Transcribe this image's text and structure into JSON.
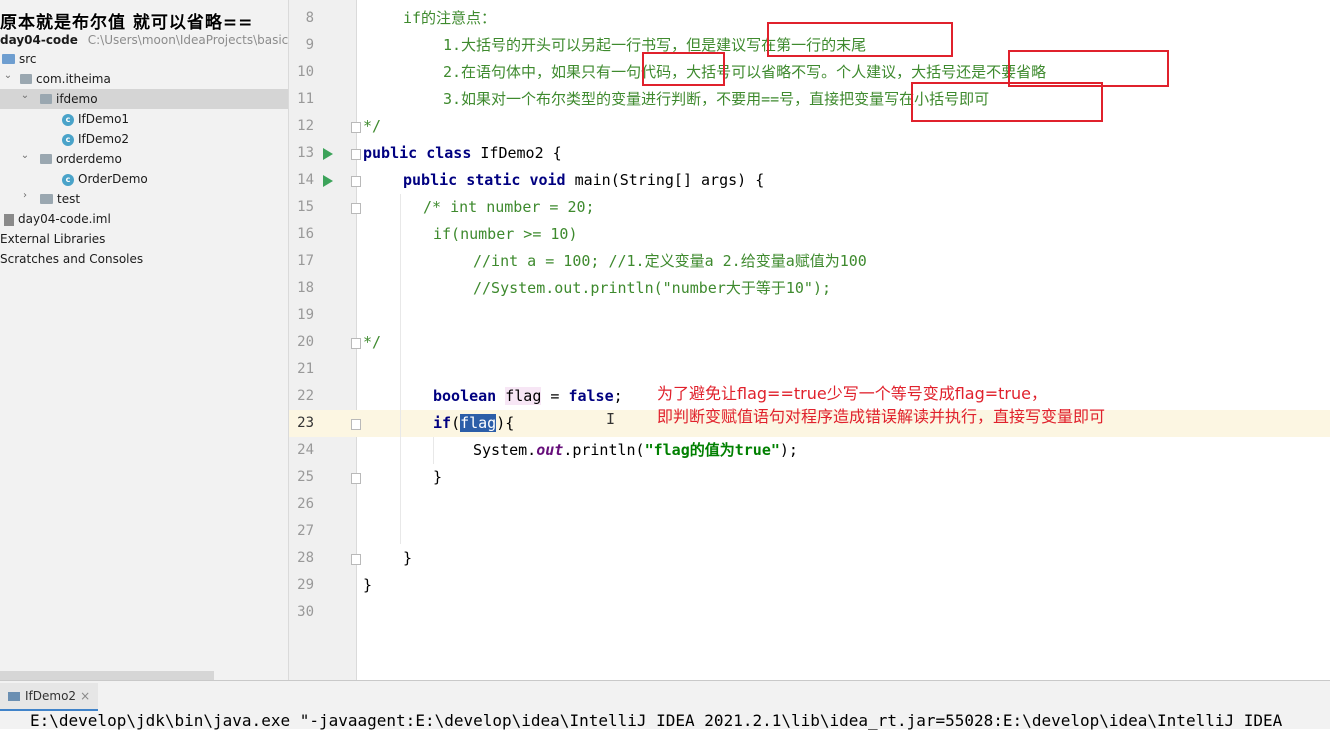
{
  "overlay_title": "原本就是布尔值 就可以省略==",
  "project": {
    "root": "day04-code",
    "root_path": "C:\\Users\\moon\\IdeaProjects\\basic-co",
    "items": [
      {
        "label": "src"
      },
      {
        "label": "com.itheima"
      },
      {
        "label": "ifdemo"
      },
      {
        "label": "IfDemo1"
      },
      {
        "label": "IfDemo2"
      },
      {
        "label": "orderdemo"
      },
      {
        "label": "OrderDemo"
      },
      {
        "label": "test"
      },
      {
        "label": "day04-code.iml"
      },
      {
        "label": "External Libraries"
      },
      {
        "label": "Scratches and Consoles"
      }
    ]
  },
  "editor": {
    "line_numbers": [
      "8",
      "9",
      "10",
      "11",
      "12",
      "13",
      "14",
      "15",
      "16",
      "17",
      "18",
      "19",
      "20",
      "21",
      "22",
      "23",
      "24",
      "25",
      "26",
      "27",
      "28",
      "29",
      "30"
    ],
    "doc": {
      "l8": "if的注意点：",
      "l9": "1.大括号的开头可以另起一行书写，但是建议写在第一行的末尾",
      "l10": "2.在语句体中，如果只有一句代码，大括号可以省略不写。个人建议，大括号还是不要省略",
      "l11": "3.如果对一个布尔类型的变量进行判断，不要用==号，直接把变量写在小括号即可",
      "l12": "*/"
    },
    "code": {
      "public": "public",
      "class": "class",
      "class_name": "IfDemo2 {",
      "static": "static",
      "void": "void",
      "main_sig": "main(String[] args) {",
      "c15": "/* int number = 20;",
      "c16": "if(number >= 10)",
      "c17": "//int a = 100; //1.定义变量a 2.给变量a赋值为100",
      "c18": "//System.out.println(\"number大于等于10\");",
      "c20": "*/",
      "boolean": "boolean",
      "flag": "flag",
      "assign": " = ",
      "false": "false",
      "semi": ";",
      "if": "if",
      "lparen": "(",
      "rparen_brace": "){",
      "system": "System.",
      "out": "out",
      "println": ".println(",
      "str": "\"flag的值为true\"",
      "end": ");",
      "close_brace": "}"
    }
  },
  "annotation": {
    "line1": "为了避免让flag==true少写一个等号变成flag=true，",
    "line2": "即判断变赋值语句对程序造成错误解读并执行，直接写变量即可"
  },
  "bottom": {
    "tab": "IfDemo2",
    "console": "E:\\develop\\jdk\\bin\\java.exe \"-javaagent:E:\\develop\\idea\\IntelliJ IDEA 2021.2.1\\lib\\idea_rt.jar=55028:E:\\develop\\idea\\IntelliJ IDEA"
  }
}
